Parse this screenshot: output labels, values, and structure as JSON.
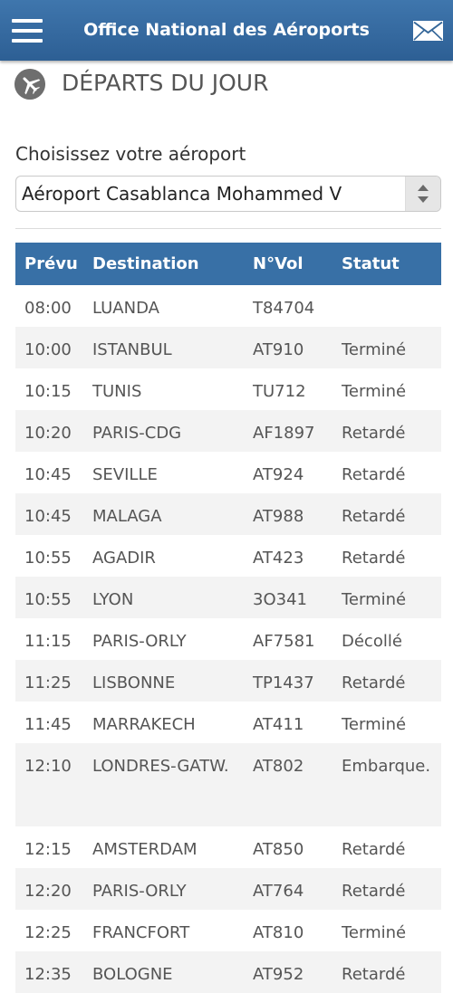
{
  "header": {
    "title": "Office National des Aéroports",
    "menu_icon": "hamburger-menu-icon",
    "mail_icon": "envelope-icon"
  },
  "section": {
    "icon": "airplane-icon",
    "title": "DÉPARTS DU JOUR"
  },
  "airport_select": {
    "label": "Choisissez votre aéroport",
    "value": "Aéroport Casablanca Mohammed V"
  },
  "table": {
    "headers": [
      "Prévu",
      "Destination",
      "N°Vol",
      "Statut"
    ],
    "rows": [
      {
        "time": "08:00",
        "destination": "LUANDA",
        "flight": "T84704",
        "status": ""
      },
      {
        "time": "10:00",
        "destination": "ISTANBUL",
        "flight": "AT910",
        "status": "Terminé"
      },
      {
        "time": "10:15",
        "destination": "TUNIS",
        "flight": "TU712",
        "status": "Terminé"
      },
      {
        "time": "10:20",
        "destination": "PARIS-CDG",
        "flight": "AF1897",
        "status": "Retardé"
      },
      {
        "time": "10:45",
        "destination": "SEVILLE",
        "flight": "AT924",
        "status": "Retardé"
      },
      {
        "time": "10:45",
        "destination": "MALAGA",
        "flight": "AT988",
        "status": "Retardé"
      },
      {
        "time": "10:55",
        "destination": "AGADIR",
        "flight": "AT423",
        "status": "Retardé"
      },
      {
        "time": "10:55",
        "destination": "LYON",
        "flight": "3O341",
        "status": "Terminé"
      },
      {
        "time": "11:15",
        "destination": "PARIS-ORLY",
        "flight": "AF7581",
        "status": "Décollé"
      },
      {
        "time": "11:25",
        "destination": "LISBONNE",
        "flight": "TP1437",
        "status": "Retardé"
      },
      {
        "time": "11:45",
        "destination": "MARRAKECH",
        "flight": "AT411",
        "status": "Terminé"
      },
      {
        "time": "12:10",
        "destination": "LONDRES-GATW.",
        "flight": "AT802",
        "status": "Embarque."
      },
      {
        "time": "12:15",
        "destination": "AMSTERDAM",
        "flight": "AT850",
        "status": "Retardé"
      },
      {
        "time": "12:20",
        "destination": "PARIS-ORLY",
        "flight": "AT764",
        "status": "Retardé"
      },
      {
        "time": "12:25",
        "destination": "FRANCFORT",
        "flight": "AT810",
        "status": "Terminé"
      },
      {
        "time": "12:35",
        "destination": "BOLOGNE",
        "flight": "AT952",
        "status": "Retardé"
      }
    ]
  }
}
